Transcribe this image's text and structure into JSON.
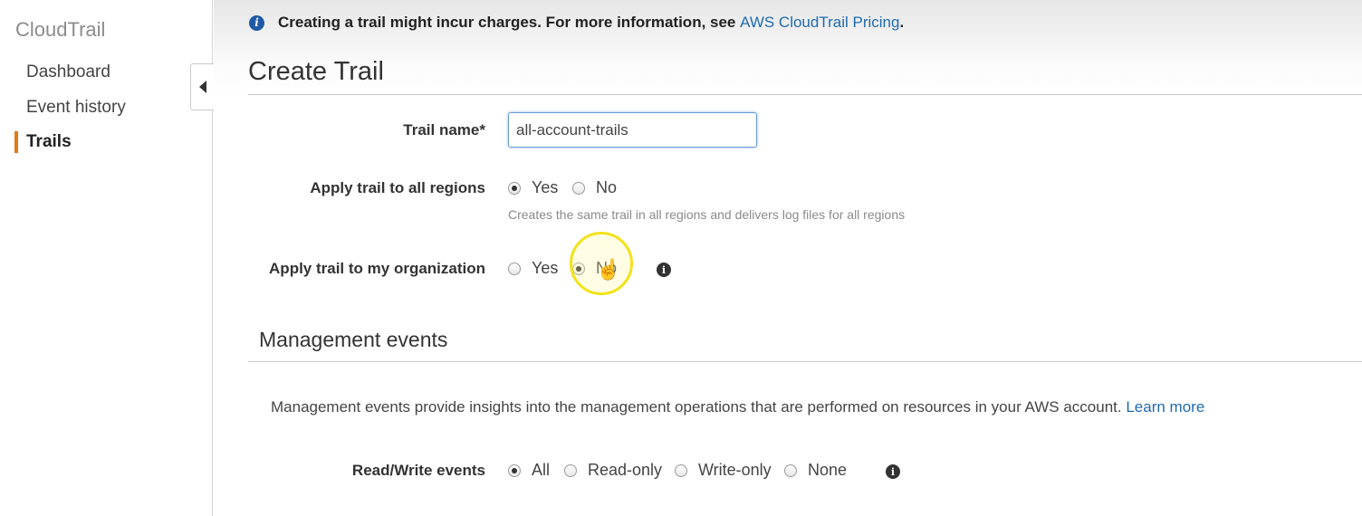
{
  "sidebar": {
    "brand": "CloudTrail",
    "items": [
      {
        "label": "Dashboard"
      },
      {
        "label": "Event history"
      },
      {
        "label": "Trails"
      }
    ]
  },
  "banner": {
    "text": "Creating a trail might incur charges. For more information, see ",
    "link": "AWS CloudTrail Pricing",
    "suffix": "."
  },
  "page": {
    "title": "Create Trail"
  },
  "form": {
    "trail_name_label": "Trail name*",
    "trail_name_value": "all-account-trails",
    "all_regions": {
      "label": "Apply trail to all regions",
      "options": [
        "Yes",
        "No"
      ],
      "selected": "Yes",
      "hint": "Creates the same trail in all regions and delivers log files for all regions"
    },
    "organization": {
      "label": "Apply trail to my organization",
      "options": [
        "Yes",
        "No"
      ],
      "selected": "No"
    }
  },
  "management": {
    "title": "Management events",
    "description": "Management events provide insights into the management operations that are performed on resources in your AWS account. ",
    "learn_more": "Learn more",
    "rw_label": "Read/Write events",
    "rw_options": [
      "All",
      "Read-only",
      "Write-only",
      "None"
    ],
    "rw_selected": "All"
  }
}
